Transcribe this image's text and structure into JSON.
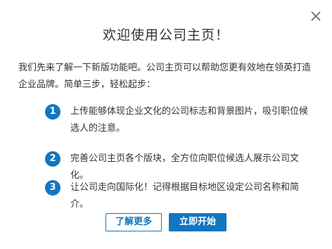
{
  "dialog": {
    "title": "欢迎使用公司主页！",
    "intro": "我们先来了解一下新版功能吧。公司主页可以帮助您更有效地在领英打造企业品牌。简单三步，轻松起步：",
    "steps": [
      {
        "number": "1",
        "text": "上传能够体现企业文化的公司标志和背景图片，吸引职位候选人的注意。"
      },
      {
        "number": "2",
        "text": "完善公司主页各个版块，全方位向职位候选人展示公司文化。"
      },
      {
        "number": "3",
        "text": "让公司走向国际化！记得根据目标地区设定公司名称和简介。"
      }
    ],
    "learn_more_label": "了解更多",
    "start_now_label": "立即开始",
    "close_icon": "close-icon"
  },
  "colors": {
    "accent": "#1276c0",
    "text": "#333333",
    "background": "#ffffff"
  }
}
